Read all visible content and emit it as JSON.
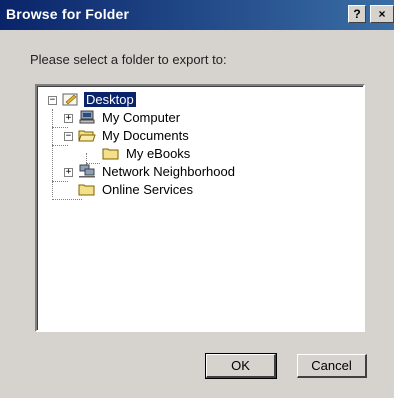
{
  "window": {
    "title": "Browse for Folder",
    "help_glyph": "?",
    "close_glyph": "×"
  },
  "prompt": "Please select a folder to export to:",
  "tree": {
    "items": [
      {
        "label": "Desktop",
        "icon": "desktop-icon",
        "expander": "−",
        "selected": true
      },
      {
        "label": "My Computer",
        "icon": "computer-icon",
        "expander": "+"
      },
      {
        "label": "My Documents",
        "icon": "folder-open-icon",
        "expander": "−"
      },
      {
        "label": "My eBooks",
        "icon": "folder-icon",
        "expander": ""
      },
      {
        "label": "Network Neighborhood",
        "icon": "network-icon",
        "expander": "+"
      },
      {
        "label": "Online Services",
        "icon": "folder-icon",
        "expander": ""
      }
    ]
  },
  "buttons": {
    "ok": "OK",
    "cancel": "Cancel"
  },
  "colors": {
    "title_bar": "#0a246a",
    "selection": "#0a246a",
    "face": "#d6d3ce"
  }
}
